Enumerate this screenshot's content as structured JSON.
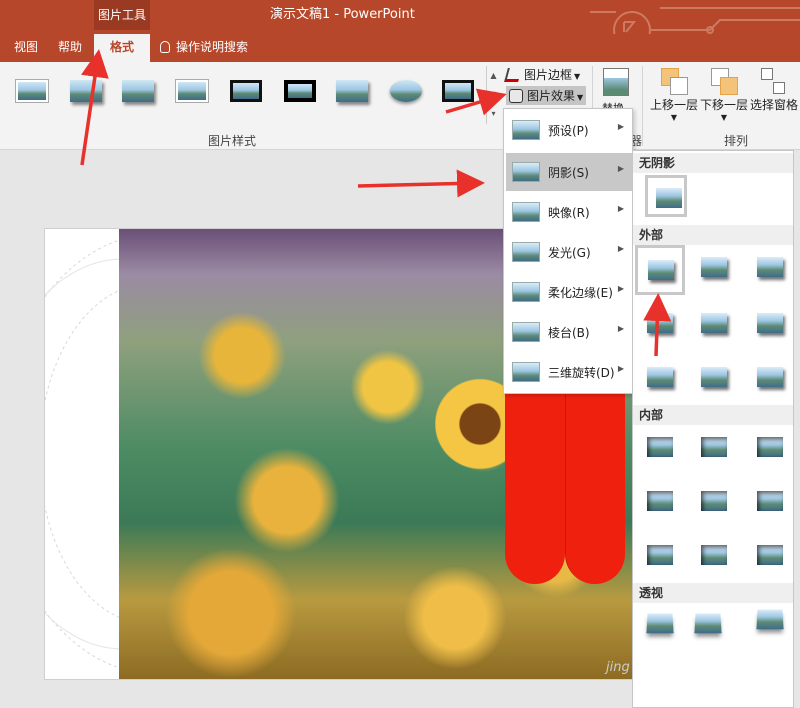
{
  "window": {
    "context_tab_group": "图片工具",
    "title": "演示文稿1  -  PowerPoint"
  },
  "tabs": {
    "view": "视图",
    "help": "帮助",
    "format": "格式",
    "tell_me": "操作说明搜索"
  },
  "ribbon": {
    "picture_styles_group": "图片样式",
    "picture_border": "图片边框",
    "picture_effects": "图片效果",
    "replace_label": "替换",
    "arrange_group": "排列",
    "bring_forward": "上移一层",
    "send_backward": "下移一层",
    "selection_pane": "选择窗格",
    "partial_group_label": "器"
  },
  "effects_menu": {
    "items": [
      {
        "label": "预设(P)"
      },
      {
        "label": "阴影(S)",
        "active": true
      },
      {
        "label": "映像(R)"
      },
      {
        "label": "发光(G)"
      },
      {
        "label": "柔化边缘(E)"
      },
      {
        "label": "棱台(B)"
      },
      {
        "label": "三维旋转(D)"
      }
    ]
  },
  "shadow_submenu": {
    "no_shadow": "无阴影",
    "outer": "外部",
    "inner": "内部",
    "perspective": "透视"
  },
  "watermark": "jing",
  "colors": {
    "titlebar": "#b7472a",
    "ribbon": "#f3f3f3",
    "annotation_arrow": "#e8312b",
    "red_shape": "#f0200f"
  }
}
